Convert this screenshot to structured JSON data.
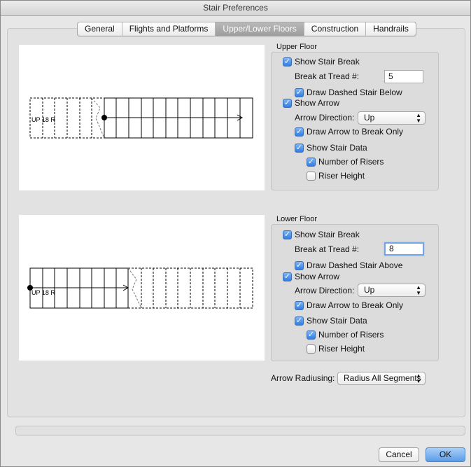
{
  "window": {
    "title": "Stair Preferences"
  },
  "tabs": [
    {
      "label": "General",
      "active": false
    },
    {
      "label": "Flights and Platforms",
      "active": false
    },
    {
      "label": "Upper/Lower Floors",
      "active": true
    },
    {
      "label": "Construction",
      "active": false
    },
    {
      "label": "Handrails",
      "active": false
    }
  ],
  "upper_floor": {
    "heading": "Upper Floor",
    "preview_label": "UP 18 R",
    "show_stair_break": {
      "label": "Show Stair Break",
      "checked": true
    },
    "break_at_tread": {
      "label": "Break at Tread #:",
      "value": "5"
    },
    "draw_dashed": {
      "label": "Draw Dashed Stair Below",
      "checked": true
    },
    "show_arrow": {
      "label": "Show Arrow",
      "checked": true
    },
    "arrow_direction": {
      "label": "Arrow Direction:",
      "value": "Up"
    },
    "draw_arrow_to_break": {
      "label": "Draw Arrow to Break Only",
      "checked": true
    },
    "show_stair_data": {
      "label": "Show Stair Data",
      "checked": true
    },
    "number_of_risers": {
      "label": "Number of Risers",
      "checked": true
    },
    "riser_height": {
      "label": "Riser Height",
      "checked": false
    }
  },
  "lower_floor": {
    "heading": "Lower Floor",
    "preview_label": "UP 18 R",
    "show_stair_break": {
      "label": "Show Stair Break",
      "checked": true
    },
    "break_at_tread": {
      "label": "Break at Tread #:",
      "value": "8"
    },
    "draw_dashed": {
      "label": "Draw Dashed Stair Above",
      "checked": true
    },
    "show_arrow": {
      "label": "Show Arrow",
      "checked": true
    },
    "arrow_direction": {
      "label": "Arrow Direction:",
      "value": "Up"
    },
    "draw_arrow_to_break": {
      "label": "Draw Arrow to Break Only",
      "checked": true
    },
    "show_stair_data": {
      "label": "Show Stair Data",
      "checked": true
    },
    "number_of_risers": {
      "label": "Number of Risers",
      "checked": true
    },
    "riser_height": {
      "label": "Riser Height",
      "checked": false
    }
  },
  "arrow_radiusing": {
    "label": "Arrow Radiusing:",
    "value": "Radius All Segments"
  },
  "buttons": {
    "cancel": "Cancel",
    "ok": "OK"
  },
  "colors": {
    "ok_button": "#5c9ce9",
    "checkbox_checked": "#2f7ee5",
    "active_tab": "#a9a9a9"
  },
  "icons": {
    "checkmark": "checkmark-icon",
    "popup_arrows": "updown-chevron-icon"
  }
}
